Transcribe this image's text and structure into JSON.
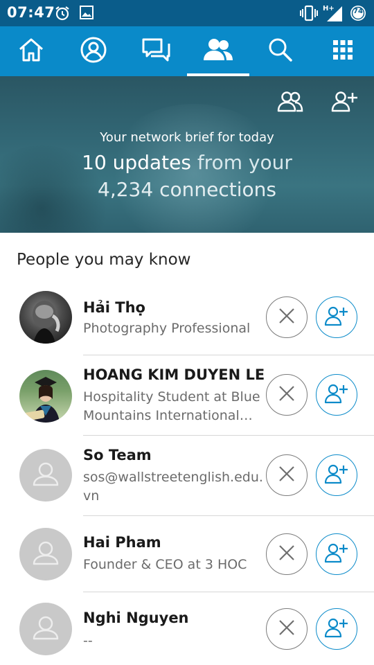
{
  "status_bar": {
    "time": "07:47",
    "network": "H+",
    "battery": "74"
  },
  "nav": {
    "tabs": [
      {
        "icon": "home-icon"
      },
      {
        "icon": "profile-icon"
      },
      {
        "icon": "messages-icon"
      },
      {
        "icon": "network-icon",
        "active": true
      },
      {
        "icon": "search-icon"
      },
      {
        "icon": "apps-grid-icon"
      }
    ]
  },
  "hero": {
    "brief": "Your network brief for today",
    "updates": "10 updates",
    "from_your": "from your",
    "connections": "4,234 connections"
  },
  "pymk": {
    "title": "People you may know",
    "people": [
      {
        "name": "Hải Thọ",
        "desc": "Photography Professional",
        "avatar": "photo"
      },
      {
        "name": "HOANG KIM DUYEN LE",
        "desc": "Hospitality Student at Blue Mountains International…",
        "avatar": "photo"
      },
      {
        "name": "So Team",
        "desc": "sos@wallstreetenglish.edu.vn",
        "avatar": "placeholder"
      },
      {
        "name": "Hai Pham",
        "desc": "Founder & CEO at 3 HOC",
        "avatar": "placeholder"
      },
      {
        "name": "Nghi Nguyen",
        "desc": "--",
        "avatar": "placeholder"
      }
    ]
  },
  "colors": {
    "status_bar": "#0a5c8a",
    "nav_bar": "#0a8ac9",
    "accent": "#0a8ac9"
  }
}
